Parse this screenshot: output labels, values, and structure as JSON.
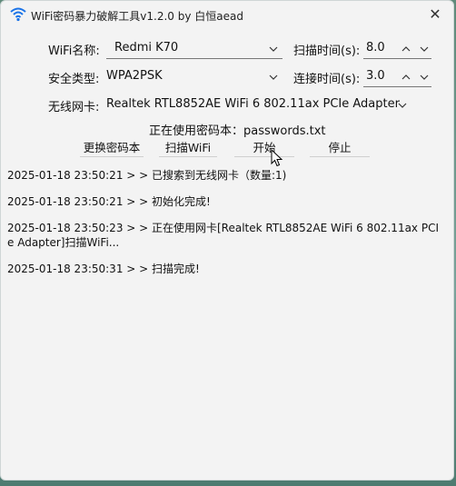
{
  "window": {
    "title": "WiFi密码暴力破解工具v1.2.0 by 白恒aead",
    "close_glyph": "✕"
  },
  "form": {
    "wifi_name_label": "WiFi名称:",
    "wifi_name_value": "Redmi K70",
    "security_label": "安全类型:",
    "security_value": "WPA2PSK",
    "adapter_label": "无线网卡:",
    "adapter_value": "Realtek RTL8852AE WiFi 6 802.11ax PCIe Adapter",
    "scan_time_label": "扫描时间(s):",
    "scan_time_value": "8.0",
    "connect_time_label": "连接时间(s):",
    "connect_time_value": "3.0"
  },
  "password": {
    "label": "正在使用密码本：passwords.txt"
  },
  "buttons": {
    "change_book": "更换密码本",
    "scan_wifi": "扫描WiFi",
    "start": "开始",
    "stop": "停止"
  },
  "log": [
    "2025-01-18 23:50:21 > > 已搜索到无线网卡（数量:1)",
    "2025-01-18 23:50:21 > > 初始化完成!",
    "2025-01-18 23:50:23 > > 正在使用网卡[Realtek RTL8852AE WiFi 6 802.11ax PCIe Adapter]扫描WiFi...",
    "2025-01-18 23:50:31 > > 扫描完成!"
  ]
}
